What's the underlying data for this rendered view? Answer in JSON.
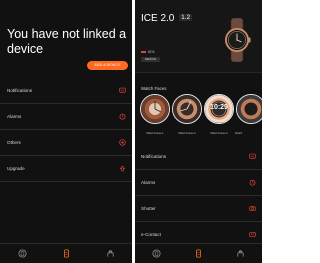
{
  "left": {
    "title": "You have not linked a device",
    "add_device_label": "ADD A DEVICE",
    "menu": [
      {
        "label": "Notifications",
        "icon": "notification-icon"
      },
      {
        "label": "Alarms",
        "icon": "alarm-icon"
      },
      {
        "label": "Others",
        "icon": "others-icon"
      },
      {
        "label": "Upgrade",
        "icon": "upgrade-icon"
      }
    ]
  },
  "right": {
    "device": {
      "name": "ICE 2.0",
      "version": "1.2",
      "battery": "61%"
    },
    "remove_label": "REMOVE",
    "faces_title": "Watch Faces",
    "faces": [
      {
        "label": "Watch Faces 1"
      },
      {
        "label": "Watch Faces 2"
      },
      {
        "label": "Watch Faces 3"
      },
      {
        "label": "Watch"
      }
    ],
    "menu": [
      {
        "label": "Notifications",
        "icon": "notification-icon"
      },
      {
        "label": "Alarms",
        "icon": "alarm-icon"
      },
      {
        "label": "Shutter",
        "icon": "camera-icon"
      },
      {
        "label": "e-Contact",
        "icon": "contact-card-icon"
      }
    ]
  },
  "nav": [
    {
      "icon": "devices-icon",
      "active": false
    },
    {
      "icon": "watch-icon",
      "active": true
    },
    {
      "icon": "profile-icon",
      "active": false
    }
  ],
  "colors": {
    "accent": "#ff6a20",
    "icon_red": "#e6453a",
    "background": "#111111"
  }
}
